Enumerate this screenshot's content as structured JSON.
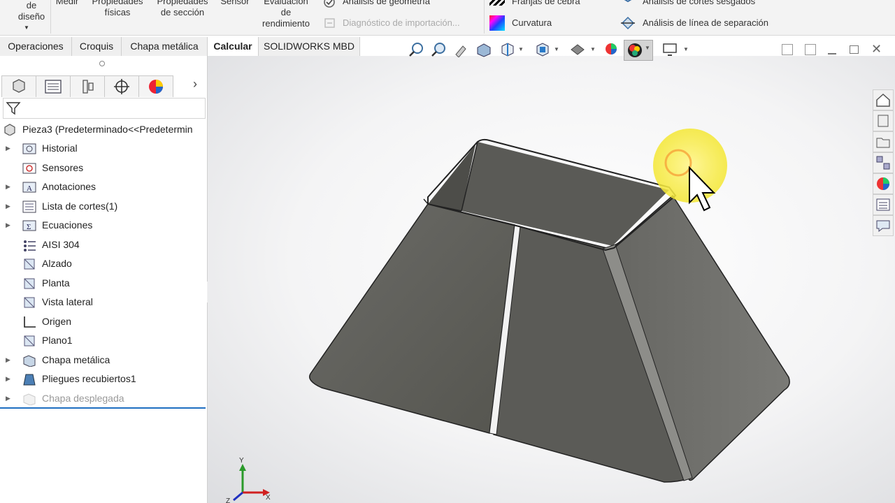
{
  "ribbon": {
    "design_label": "de\ndiseño",
    "medir": "Medir",
    "prop_fisicas": "Propiedades\nfísicas",
    "prop_seccion": "Propiedades\nde sección",
    "sensor": "Sensor",
    "evaluacion": "Evaluación\nde\nrendimiento",
    "analisis_geometria": "Análisis de geometría",
    "diagnostico": "Diagnóstico de importación...",
    "franjas": "Franjas de cebra",
    "curvatura": "Curvatura",
    "cortes_sesgados": "Análisis de cortes sesgados",
    "linea_separacion": "Análisis de línea de separación"
  },
  "tabs": [
    "Operaciones",
    "Croquis",
    "Chapa metálica",
    "Calcular",
    "SOLIDWORKS MBD"
  ],
  "active_tab": "Calcular",
  "tree": {
    "root": "Pieza3  (Predeterminado<<Predetermin",
    "items": [
      {
        "label": "Historial",
        "arrow": "▶",
        "icon": "history-icon"
      },
      {
        "label": "Sensores",
        "arrow": "",
        "icon": "sensor-icon"
      },
      {
        "label": "Anotaciones",
        "arrow": "▶",
        "icon": "annotation-icon"
      },
      {
        "label": "Lista de cortes(1)",
        "arrow": "▶",
        "icon": "cut-list-icon"
      },
      {
        "label": "Ecuaciones",
        "arrow": "▶",
        "icon": "equation-icon"
      },
      {
        "label": "AISI 304",
        "arrow": "",
        "icon": "material-icon"
      },
      {
        "label": "Alzado",
        "arrow": "",
        "icon": "plane-icon"
      },
      {
        "label": "Planta",
        "arrow": "",
        "icon": "plane-icon"
      },
      {
        "label": "Vista lateral",
        "arrow": "",
        "icon": "plane-icon"
      },
      {
        "label": "Origen",
        "arrow": "",
        "icon": "origin-icon"
      },
      {
        "label": "Plano1",
        "arrow": "",
        "icon": "plane-icon"
      },
      {
        "label": "Chapa metálica",
        "arrow": "▶",
        "icon": "sheet-metal-icon"
      },
      {
        "label": "Pliegues recubiertos1",
        "arrow": "▶",
        "icon": "lofted-bend-icon"
      },
      {
        "label": "Chapa desplegada",
        "arrow": "▶",
        "icon": "flat-pattern-icon"
      }
    ]
  },
  "triad": {
    "x": "X",
    "y": "Y",
    "z": "Z"
  },
  "colors": {
    "accent": "#1f6fc1",
    "model": "#5f5f5c"
  }
}
